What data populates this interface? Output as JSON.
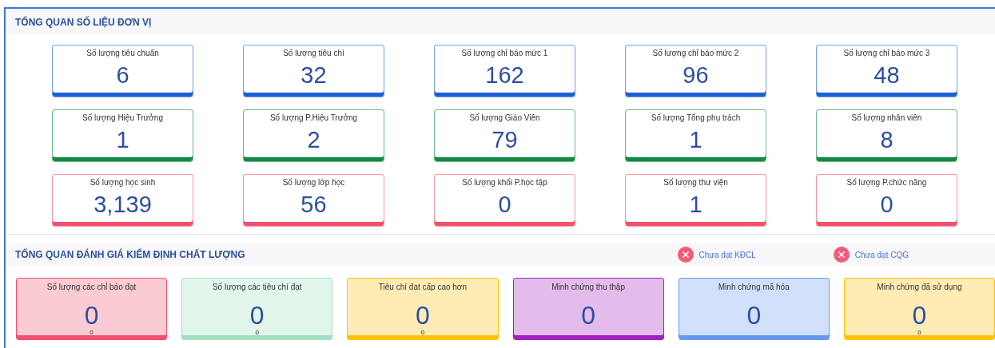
{
  "unit_overview": {
    "title": "TỔNG QUAN SỐ LIỆU ĐƠN VỊ",
    "rows": [
      {
        "color": "#1a5fd6",
        "cards": [
          {
            "label": "Số lượng tiêu chuẩn",
            "value": "6"
          },
          {
            "label": "Số lượng tiêu chí",
            "value": "32"
          },
          {
            "label": "Số lượng chỉ báo mức 1",
            "value": "162"
          },
          {
            "label": "Số lượng chỉ báo mức 2",
            "value": "96"
          },
          {
            "label": "Số lượng chỉ báo mức 3",
            "value": "48"
          }
        ]
      },
      {
        "color": "#138a43",
        "cards": [
          {
            "label": "Số lượng Hiệu Trưởng",
            "value": "1"
          },
          {
            "label": "Số lượng P.Hiệu Trưởng",
            "value": "2"
          },
          {
            "label": "Số lượng Giáo Viên",
            "value": "79"
          },
          {
            "label": "Số lượng Tổng phụ trách",
            "value": "1"
          },
          {
            "label": "Số lượng nhân viên",
            "value": "8"
          }
        ]
      },
      {
        "color": "#f0506e",
        "cards": [
          {
            "label": "Số lượng học sinh",
            "value": "3,139"
          },
          {
            "label": "Số lượng lớp học",
            "value": "56"
          },
          {
            "label": "Số lượng khối P.học tập",
            "value": "0"
          },
          {
            "label": "Số lượng thư viện",
            "value": "1"
          },
          {
            "label": "Số lượng P.chức năng",
            "value": "0"
          }
        ]
      }
    ]
  },
  "quality_overview": {
    "title": "TỔNG QUAN ĐÁNH GIÁ KIỂM ĐỊNH CHẤT LƯỢNG",
    "status": [
      {
        "label": "Chưa đạt KĐCL"
      },
      {
        "label": "Chưa đạt CQG"
      }
    ],
    "cards": [
      {
        "label": "Số lượng các chỉ báo đạt",
        "value": "0",
        "sub": "0",
        "color": "#f0506e"
      },
      {
        "label": "Số lượng các tiêu chí đạt",
        "value": "0",
        "sub": "0",
        "color": "#a0e0c0"
      },
      {
        "label": "Tiêu chí đạt cấp cao hơn",
        "value": "0",
        "sub": "0",
        "color": "#ffc107"
      },
      {
        "label": "Minh chứng thu thập",
        "value": "0",
        "color": "#a020c0"
      },
      {
        "label": "Minh chứng mã hóa",
        "value": "0",
        "color": "#6699ee"
      },
      {
        "label": "Minh chứng đã sử dụng",
        "value": "0",
        "sub": "0",
        "color": "#ffc107"
      }
    ]
  }
}
